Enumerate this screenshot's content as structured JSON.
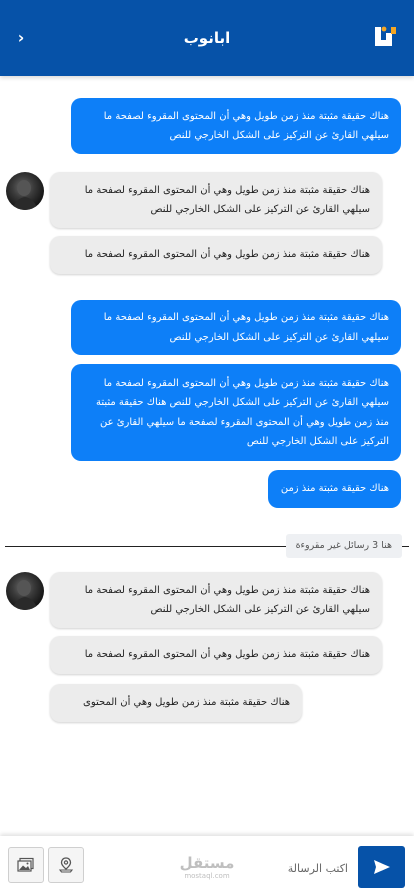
{
  "header": {
    "title": "ابانوب",
    "back_icon": "chevron-right-icon",
    "logo_icon": "app-logo-icon",
    "color": "#0652a8"
  },
  "messages": [
    {
      "side": "out",
      "text": "هناك حقيقة مثبتة منذ زمن طويل وهي أن المحتوى المقروء لصفحة ما سيلهي القارئ عن التركيز على الشكل الخارجي للنص"
    },
    {
      "side": "in",
      "text": "هناك حقيقة مثبتة منذ زمن طويل وهي أن المحتوى المقروء لصفحة ما سيلهي القارئ عن التركيز على الشكل الخارجي للنص"
    },
    {
      "side": "in",
      "text": "هناك حقيقة مثبتة منذ زمن طويل وهي أن المحتوى المقروء لصفحة ما"
    },
    {
      "side": "out",
      "text": "هناك حقيقة مثبتة منذ زمن طويل وهي أن المحتوى المقروء لصفحة ما سيلهي القارئ عن التركيز على الشكل الخارجي للنص"
    },
    {
      "side": "out",
      "text": "هناك حقيقة مثبتة منذ زمن طويل وهي أن المحتوى المقروء لصفحة ما سيلهي القارئ عن التركيز على الشكل الخارجي للنص هناك حقيقة مثبتة منذ زمن طويل وهي أن المحتوى المقروء لصفحة ما سيلهي القارئ عن التركيز على الشكل الخارجي للنص"
    },
    {
      "side": "out",
      "text": "هناك حقيقة مثبتة منذ زمن"
    },
    {
      "side": "in",
      "text": "هناك حقيقة مثبتة منذ زمن طويل وهي أن المحتوى المقروء لصفحة ما سيلهي القارئ عن التركيز على الشكل الخارجي للنص"
    },
    {
      "side": "in",
      "text": "هناك حقيقة مثبتة منذ زمن طويل وهي أن المحتوى المقروء لصفحة ما"
    },
    {
      "side": "in",
      "text": "هناك حقيقة مثبتة منذ زمن طويل وهي أن المحتوى"
    }
  ],
  "unread_divider": {
    "label": "هنا 3 رسائل غير مقروءة"
  },
  "composer": {
    "placeholder": "اكتب الرسالة",
    "watermark_ar": "مستقل",
    "watermark_latin": "mostaql.com",
    "send_icon": "send-icon",
    "image_icon": "image-icon",
    "location_icon": "location-icon"
  },
  "colors": {
    "outgoing": "#0d7ff8",
    "incoming": "#ececec",
    "header": "#0652a8"
  }
}
